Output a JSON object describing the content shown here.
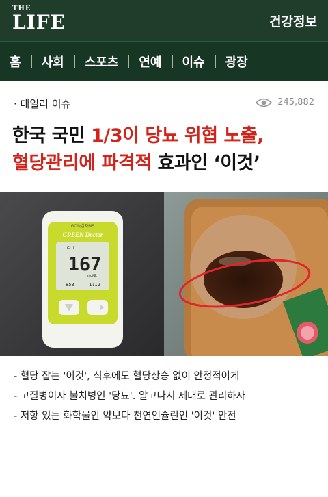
{
  "header": {
    "logo_small": "THE",
    "logo_big": "LIFE",
    "section": "건강정보"
  },
  "nav": {
    "items": [
      "홈",
      "사회",
      "스포츠",
      "연예",
      "이슈",
      "광장"
    ]
  },
  "meta": {
    "category": "· 데일리 이슈",
    "views": "245,882"
  },
  "headline": {
    "line1_a": "한국 국민 ",
    "line1_b": "1/3이 당뇨 위협 노출,",
    "line2_a": "혈당관리에 파격적",
    "line2_b": " 효과인 ‘이것’"
  },
  "photo": {
    "meter_brand": "GC녹십자MS",
    "meter_name": "GREEN Doctor",
    "meter_unit": "GLU",
    "meter_reading": "167",
    "meter_units": "mg/dL",
    "meter_date": "858",
    "meter_time": "1:12"
  },
  "bullets": [
    "- 혈당 잡는 '이것', 식후에도 혈당상승 없이 안정적이게",
    "- 고질병이자 불치병인 '당뇨'. 알고나서 제대로 관리하자",
    "- 저항 있는 화학물인 약보다 천연인슐린인 '이것' 안전"
  ],
  "colors": {
    "header_bg": "#1f3d2a",
    "nav_bg": "#173623",
    "accent_red": "#d3241c"
  }
}
